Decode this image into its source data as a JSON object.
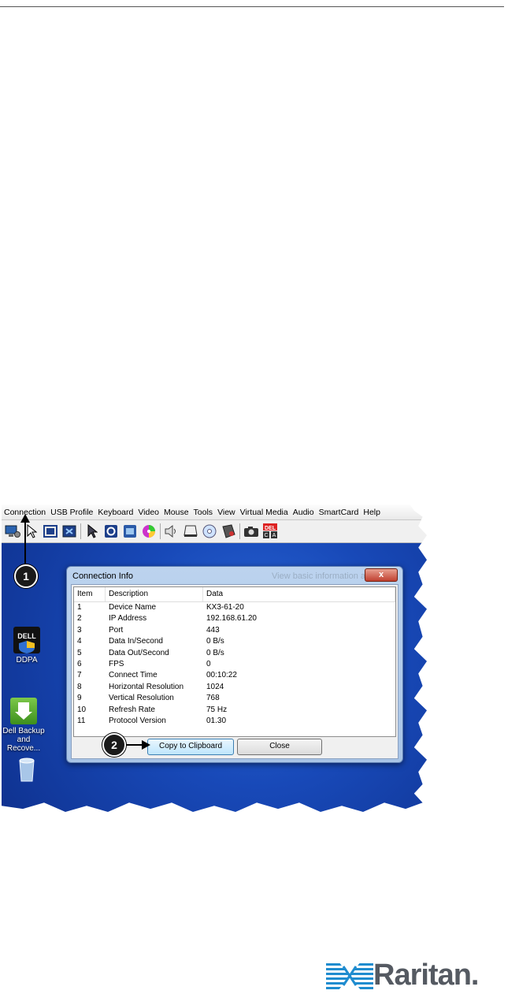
{
  "menu": [
    "Connection",
    "USB Profile",
    "Keyboard",
    "Video",
    "Mouse",
    "Tools",
    "View",
    "Virtual Media",
    "Audio",
    "SmartCard",
    "Help"
  ],
  "toolbar_icons": [
    "connection-properties-icon",
    "pointer-icon",
    "full-screen-icon",
    "auto-sense-icon",
    "single-cursor-icon",
    "refresh-icon",
    "video-settings-icon",
    "color-calibration-icon",
    "audio-icon",
    "virtual-drive-icon",
    "cd-rom-icon",
    "smartcard-icon",
    "screenshot-icon",
    "ctrl-alt-del-icon"
  ],
  "desktop": {
    "icons": [
      {
        "label": "DDPA"
      },
      {
        "label1": "Dell Backup",
        "label2": "and Recove..."
      },
      {
        "label": ""
      }
    ]
  },
  "dialog": {
    "title": "Connection Info",
    "ghost_title": "View basic information about",
    "close_glyph": "x",
    "columns": [
      "Item",
      "Description",
      "Data"
    ],
    "rows": [
      [
        "1",
        "Device Name",
        "KX3-61-20"
      ],
      [
        "2",
        "IP Address",
        "192.168.61.20"
      ],
      [
        "3",
        "Port",
        "443"
      ],
      [
        "4",
        "Data In/Second",
        "0 B/s"
      ],
      [
        "5",
        "Data Out/Second",
        "0 B/s"
      ],
      [
        "6",
        "FPS",
        "0"
      ],
      [
        "7",
        "Connect Time",
        "00:10:22"
      ],
      [
        "8",
        "Horizontal Resolution",
        "1024"
      ],
      [
        "9",
        "Vertical Resolution",
        "768"
      ],
      [
        "10",
        "Refresh Rate",
        "75 Hz"
      ],
      [
        "11",
        "Protocol Version",
        "01.30"
      ]
    ],
    "copy_label": "Copy to Clipboard",
    "close_label": "Close"
  },
  "callouts": {
    "one": "1",
    "two": "2"
  },
  "logo": {
    "text": "Raritan."
  },
  "colors": {
    "desktop": "#1849b8",
    "logo": "#1f8ccf"
  }
}
